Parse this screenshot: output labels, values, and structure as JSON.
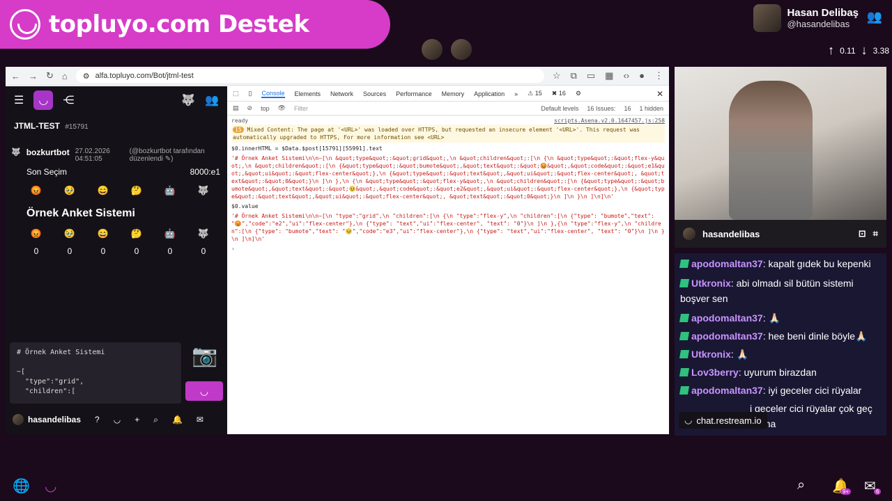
{
  "banner": {
    "text": "topluyo.com Destek"
  },
  "streamer": {
    "name": "Hasan Delibaş",
    "handle": "@hasandelibas"
  },
  "stats": {
    "up": "0.11",
    "down": "3.38"
  },
  "browser": {
    "url": "alfa.topluyo.com/Bot/jtml-test"
  },
  "app": {
    "title": "JTML-TEST",
    "id": "#15791",
    "post": {
      "author": "bozkurtbot",
      "date": "27.02.2026 04:51:05",
      "edited": "(@bozkurtbot tarafından düzenlendi ✎)",
      "selection_label": "Son Seçim",
      "selection_value": "8000:e1",
      "emojis": [
        "😡",
        "🥹",
        "😄",
        "🤔",
        "🤖",
        "🐺"
      ],
      "heading": "Örnek Anket Sistemi",
      "counts": [
        "0",
        "0",
        "0",
        "0",
        "0",
        "0"
      ]
    },
    "editor_text": "# Örnek Anket Sistemi\n\n~[\n  \"type\":\"grid\",\n  \"children\":[",
    "bottom_user": "hasandelibas"
  },
  "devtools": {
    "tabs": [
      "Console",
      "Elements",
      "Network",
      "Sources",
      "Performance",
      "Memory",
      "Application"
    ],
    "filter": {
      "context": "top",
      "placeholder": "Filter",
      "levels": "Default levels",
      "issues": "16 Issues:",
      "issues_count": "16",
      "hidden": "1 hidden"
    },
    "counters": {
      "warnings": "15",
      "errors": "16"
    },
    "ready": "ready",
    "ready_src": "scripts.Asena.v2.0.1647457.js:258",
    "warning_count": "15",
    "warning": "Mixed Content: The page at '<URL>' was loaded over HTTPS, but requested an insecure element '<URL>'. This request was automatically upgraded to HTTPS, For more information see <URL>",
    "cmd1": "$0.innerHTML = $Data.$post[15791][55991].text",
    "out1": "'# Örnek Anket Sistemi\\n\\n~[\\n &quot;type&quot;:&quot;grid&quot;,\\n &quot;children&quot;:[\\n {\\n &quot;type&quot;:&quot;flex-y&quot;,\\n &quot;children&quot;:[\\n {&quot;type&quot;:&quot;bumote&quot;,&quot;text&quot;:&quot;😡&quot;,&quot;code&quot;:&quot;e1&quot;,&quot;ui&quot;:&quot;flex-center&quot;},\\n {&quot;type&quot;:&quot;text&quot;,&quot;ui&quot;:&quot;flex-center&quot;, &quot;text&quot;:&quot;0&quot;}\\n ]\\n },\\n {\\n &quot;type&quot;:&quot;flex-y&quot;,\\n &quot;children&quot;:[\\n {&quot;type&quot;:&quot;bumote&quot;,&quot;text&quot;:&quot;🥹&quot;,&quot;code&quot;:&quot;e2&quot;,&quot;ui&quot;:&quot;flex-center&quot;},\\n {&quot;type&quot;:&quot;text&quot;,&quot;ui&quot;:&quot;flex-center&quot;, &quot;text&quot;:&quot;0&quot;}\\n ]\\n }\\n ]\\n]\\n'",
    "cmd2": "$0.value",
    "out2": "'# Örnek Anket Sistemi\\n\\n~[\\n \"type\":\"grid\",\\n \"children\":[\\n {\\n \"type\":\"flex-y\",\\n \"children\":[\\n {\"type\": \"bumote\",\"text\": \"😡\",\"code\":\"e2\",\"ui\":\"flex-center\"},\\n {\"type\": \"text\",\"ui\":\"flex-center\", \"text\": \"0\"}\\n ]\\n },{\\n \"type\":\"flex-y\",\\n \"children\":[\\n {\"type\": \"bumote\",\"text\": \"🥹\",\"code\":\"e3\",\"ui\":\"flex-center\"},\\n {\"type\": \"text\",\"ui\":\"flex-center\", \"text\": \"0\"}\\n ]\\n }\\n ]\\n]\\n'"
  },
  "webcam": {
    "name": "hasandelibas"
  },
  "chat": [
    {
      "user": "apodomaltan37",
      "text": "kapalt gıdek bu kepenki"
    },
    {
      "user": "Utkronix",
      "text": "abi olmadı sil bütün sistemi boşver sen"
    },
    {
      "user": "apodomaltan37",
      "text": "🙏🏻"
    },
    {
      "user": "apodomaltan37",
      "text": "hee beni dinle böyle🙏🏻"
    },
    {
      "user": "Utkronix",
      "text": "🙏🏻"
    },
    {
      "user": "Lov3berry",
      "text": "uyurum birazdan"
    },
    {
      "user": "apodomaltan37",
      "text": "iyi geceler cici rüyalar"
    },
    {
      "user": "",
      "text": "i geceler cici rüyalar çok geç kalma"
    }
  ],
  "restream": "chat.restream.io",
  "footer": {
    "notif_badge": "9+",
    "mail_badge": "6"
  }
}
